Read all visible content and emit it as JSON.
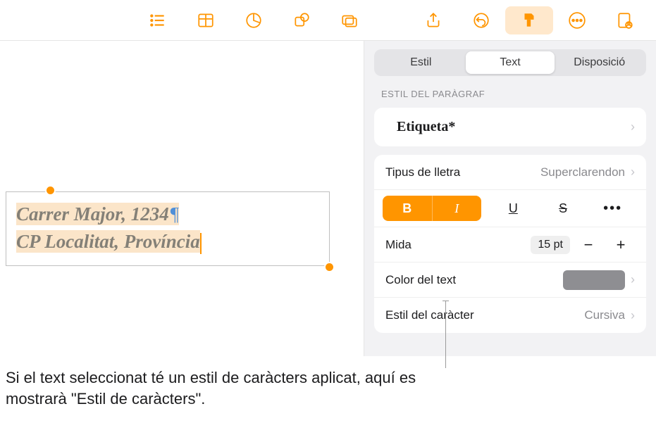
{
  "toolbar": {
    "items": [
      "list",
      "table",
      "chart",
      "shape",
      "media",
      "share",
      "undo",
      "format",
      "more",
      "collab"
    ],
    "active_index": 7
  },
  "canvas": {
    "text_line1": "Carrer Major, 1234",
    "text_line2": "CP Localitat, Província"
  },
  "inspector": {
    "tabs": {
      "style": "Estil",
      "text": "Text",
      "layout": "Disposició",
      "active": 1
    },
    "paragraph_section": "ESTIL DEL PARÀGRAF",
    "paragraph_style": "Etiqueta*",
    "font_label": "Tipus de lletra",
    "font_value": "Superclarendon",
    "bold": "B",
    "italic": "I",
    "underline": "U",
    "strike": "S",
    "size_label": "Mida",
    "size_value": "15 pt",
    "color_label": "Color del text",
    "color_hex": "#8e8e92",
    "character_label": "Estil del caràcter",
    "character_value": "Cursiva"
  },
  "caption": "Si el text seleccionat té un estil de caràcters aplicat, aquí es mostrarà \"Estil de caràcters\"."
}
